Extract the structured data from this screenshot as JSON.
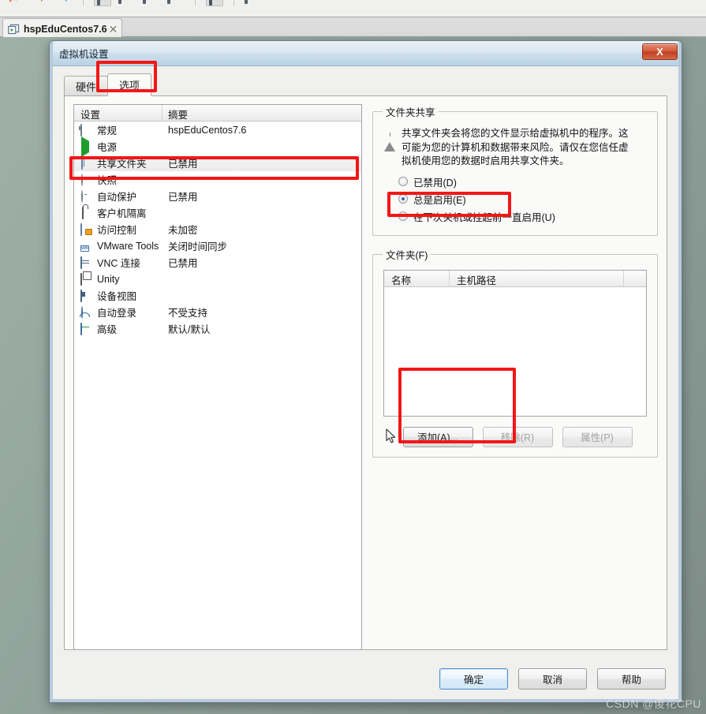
{
  "app": {
    "tab": {
      "label": "hspEduCentos7.6",
      "close": "✕",
      "icon": "vm-tab-icon"
    }
  },
  "dialog": {
    "title": "虚拟机设置",
    "close_label": "X",
    "tabs": [
      {
        "label": "硬件",
        "active": false
      },
      {
        "label": "选项",
        "active": true
      }
    ],
    "settings_table": {
      "headers": [
        "设置",
        "摘要"
      ],
      "rows": [
        {
          "icon": "monitor-icon",
          "name": "常规",
          "summary": "hspEduCentos7.6",
          "selected": false
        },
        {
          "icon": "power-icon",
          "name": "电源",
          "summary": "",
          "selected": false
        },
        {
          "icon": "folder-icon",
          "name": "共享文件夹",
          "summary": "已禁用",
          "selected": true
        },
        {
          "icon": "snapshot-icon",
          "name": "快照",
          "summary": "",
          "selected": false
        },
        {
          "icon": "clock-icon",
          "name": "自动保护",
          "summary": "已禁用",
          "selected": false
        },
        {
          "icon": "lock-icon",
          "name": "客户机隔离",
          "summary": "",
          "selected": false
        },
        {
          "icon": "access-icon",
          "name": "访问控制",
          "summary": "未加密",
          "selected": false
        },
        {
          "icon": "vmware-icon",
          "name": "VMware Tools",
          "summary": "关闭时间同步",
          "selected": false
        },
        {
          "icon": "vnc-icon",
          "name": "VNC 连接",
          "summary": "已禁用",
          "selected": false
        },
        {
          "icon": "unity-icon",
          "name": "Unity",
          "summary": "",
          "selected": false
        },
        {
          "icon": "deviceview-icon",
          "name": "设备视图",
          "summary": "",
          "selected": false
        },
        {
          "icon": "autologin-icon",
          "name": "自动登录",
          "summary": "不受支持",
          "selected": false
        },
        {
          "icon": "advanced-icon",
          "name": "高级",
          "summary": "默认/默认",
          "selected": false
        }
      ]
    },
    "folder_sharing": {
      "legend": "文件夹共享",
      "warning_icon": "warning-icon",
      "warning_text": "共享文件夹会将您的文件显示给虚拟机中的程序。这可能为您的计算机和数据带来风险。请仅在您信任虚拟机使用您的数据时启用共享文件夹。",
      "options": [
        {
          "label": "已禁用(D)",
          "checked": false
        },
        {
          "label": "总是启用(E)",
          "checked": true
        },
        {
          "label": "在下次关机或挂起前一直启用(U)",
          "checked": false
        }
      ]
    },
    "folders": {
      "legend": "文件夹(F)",
      "headers": [
        "名称",
        "主机路径",
        ""
      ],
      "rows": [],
      "buttons": [
        {
          "label": "添加(A)...",
          "disabled": false
        },
        {
          "label": "移除(R)",
          "disabled": true
        },
        {
          "label": "属性(P)",
          "disabled": true
        }
      ]
    },
    "footer_buttons": [
      {
        "label": "确定",
        "default": true
      },
      {
        "label": "取消",
        "default": false
      },
      {
        "label": "帮助",
        "default": false
      }
    ]
  },
  "watermark": "CSDN @傻花CPU",
  "colors": {
    "annotation": "#f41616",
    "titlebar": "#cfe0ed",
    "close_button": "#d25a3b",
    "radio_accent": "#2a6dbf",
    "desktop": "#93a69e"
  }
}
